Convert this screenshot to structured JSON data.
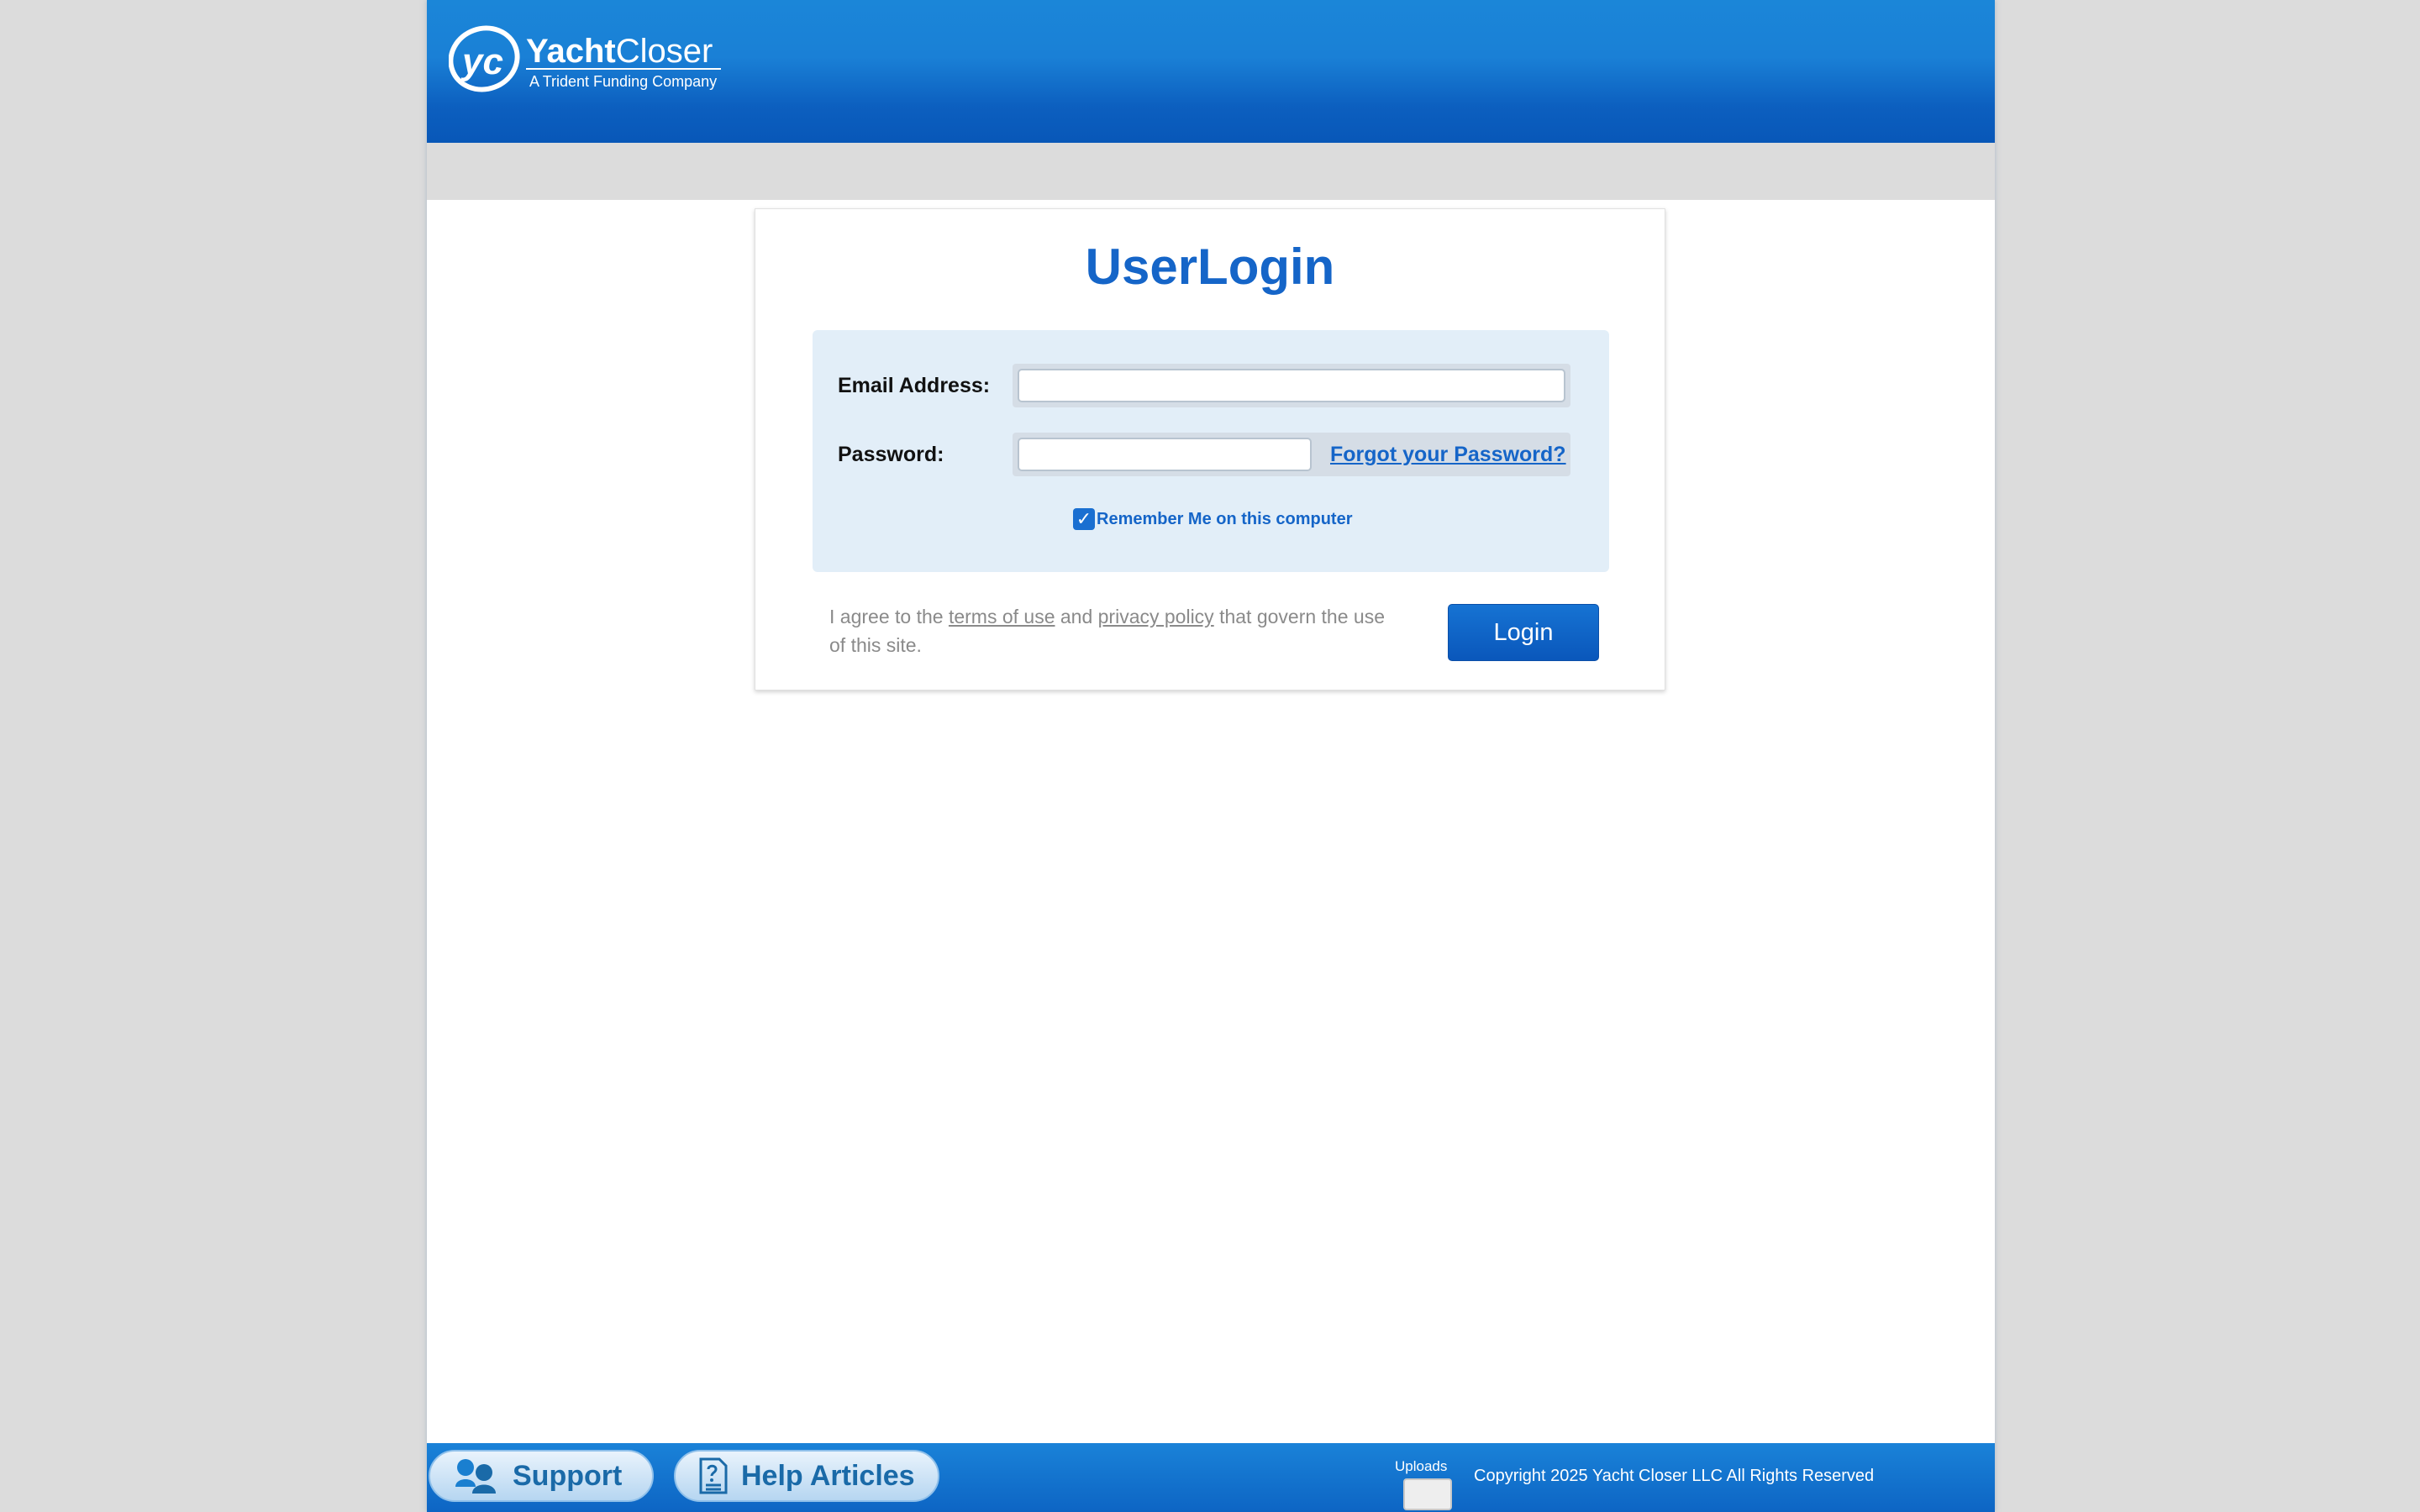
{
  "header": {
    "logo_brand_bold": "Yacht",
    "logo_brand_light": "Closer",
    "logo_monogram": "yc",
    "logo_tagline": "A Trident Funding Company"
  },
  "login": {
    "title": "UserLogin",
    "email_label": "Email Address:",
    "email_value": "",
    "password_label": "Password:",
    "password_value": "",
    "forgot_link": "Forgot your Password?",
    "remember_label": "Remember Me on this computer",
    "remember_checked": true,
    "agree_prefix": "I agree to the ",
    "terms_link": "terms of use",
    "agree_middle": " and ",
    "privacy_link": "privacy policy",
    "agree_suffix": " that govern the use of this site.",
    "login_button": "Login"
  },
  "footer": {
    "support_label": "Support",
    "help_label": "Help Articles",
    "uploads_label": "Uploads",
    "copyright": "Copyright 2025 Yacht Closer LLC All Rights Reserved"
  },
  "colors": {
    "header_blue": "#1a80d6",
    "accent_blue": "#1565c8",
    "panel_bg": "#e2eef8",
    "page_bg": "#dcdcdc"
  }
}
